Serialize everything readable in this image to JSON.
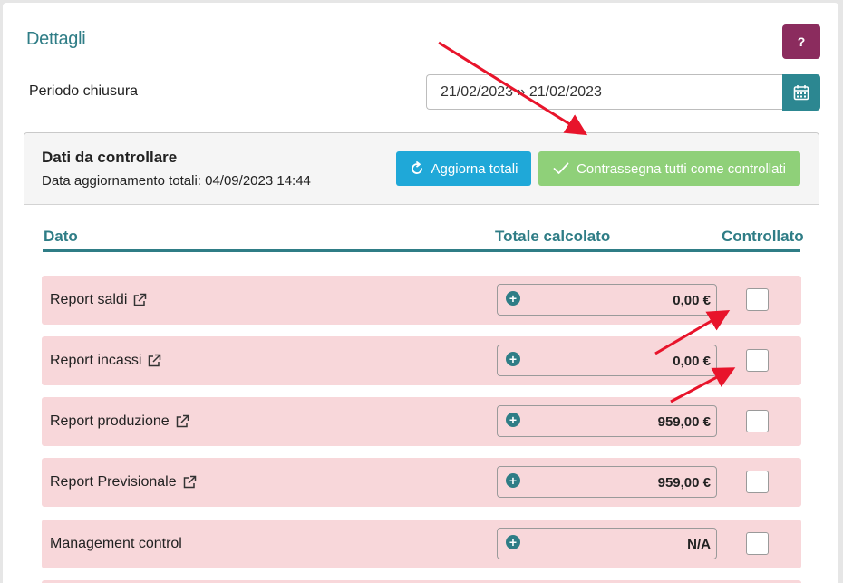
{
  "header": {
    "title": "Dettagli",
    "help_label": "?"
  },
  "period": {
    "label": "Periodo chiusura",
    "value": "21/02/2023  »  21/02/2023"
  },
  "panel": {
    "title": "Dati da controllare",
    "subtitle": "Data aggiornamento totali: 04/09/2023 14:44",
    "refresh_label": "Aggiorna totali",
    "mark_all_label": "Contrassegna tutti come controllati"
  },
  "table": {
    "col_dato": "Dato",
    "col_totale": "Totale calcolato",
    "col_controllato": "Controllato",
    "rows": [
      {
        "label": "Report saldi",
        "total": "0,00 €",
        "checked": false
      },
      {
        "label": "Report incassi",
        "total": "0,00 €",
        "checked": false
      },
      {
        "label": "Report produzione",
        "total": "959,00 €",
        "checked": false
      },
      {
        "label": "Report Previsionale",
        "total": "959,00 €",
        "checked": false
      },
      {
        "label": "Management control",
        "total": "N/A",
        "checked": false
      }
    ]
  },
  "colors": {
    "accent": "#2f7d86",
    "help": "#8b2c5e",
    "refresh": "#1fa8d8",
    "mark_all": "#8fd079",
    "row_bg": "#f8d7da",
    "annotation_arrow": "#e8142b"
  }
}
